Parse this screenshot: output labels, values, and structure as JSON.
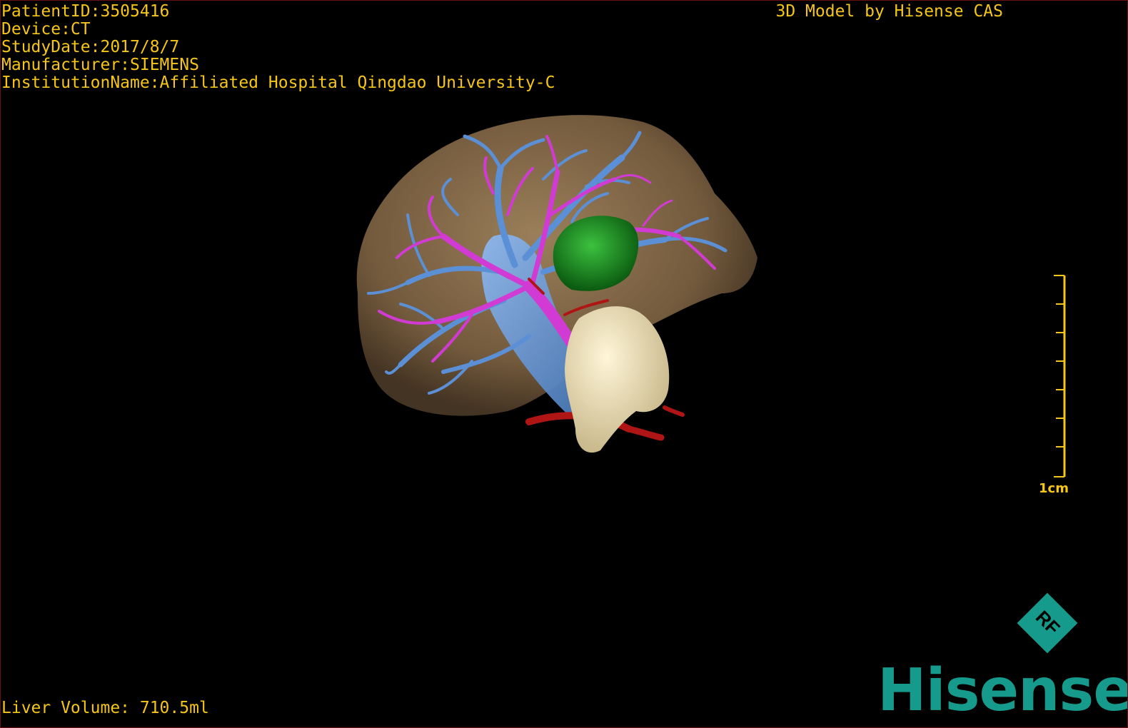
{
  "header": {
    "patient_id": "PatientID:3505416",
    "device": "Device:CT",
    "study_date": "StudyDate:2017/8/7",
    "manufacturer": "Manufacturer:SIEMENS",
    "institution": "InstitutionName:Affiliated Hospital Qingdao University-C",
    "model_credit": "3D Model by Hisense CAS"
  },
  "footer": {
    "liver_volume": "Liver Volume: 710.5ml"
  },
  "scale": {
    "label": "1cm"
  },
  "logo": {
    "badge": "RF",
    "brand": "Hisense"
  },
  "colors": {
    "overlay_text": "#f5c518",
    "liver": "#8a6d4a",
    "hepatic_vein": "#5b8fd6",
    "portal_vein": "#d13bd4",
    "hepatic_artery": "#b01515",
    "tumor_green": "#1a8a1f",
    "gallbladder_mass": "#e8dcb0",
    "brand_teal": "#169a8c"
  }
}
